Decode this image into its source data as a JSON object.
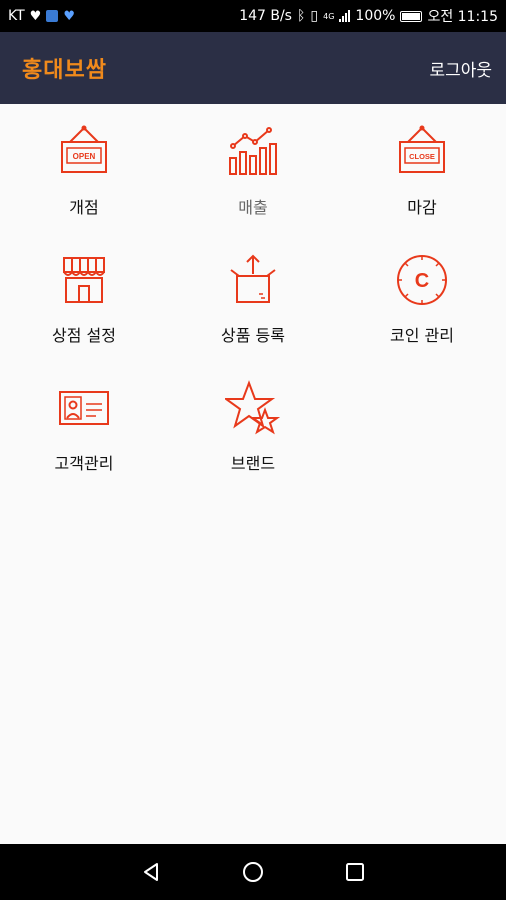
{
  "status": {
    "carrier": "KT",
    "net_speed": "147 B/s",
    "network": "4G",
    "battery": "100%",
    "time": "오전 11:15"
  },
  "appbar": {
    "title": "홍대보쌈",
    "logout_label": "로그아웃"
  },
  "menu": {
    "items": [
      {
        "label": "개점",
        "icon": "open-sign-icon"
      },
      {
        "label": "매출",
        "icon": "sales-chart-icon"
      },
      {
        "label": "마감",
        "icon": "close-sign-icon"
      },
      {
        "label": "상점 설정",
        "icon": "store-icon"
      },
      {
        "label": "상품 등록",
        "icon": "product-box-icon"
      },
      {
        "label": "코인 관리",
        "icon": "coin-icon"
      },
      {
        "label": "고객관리",
        "icon": "customer-card-icon"
      },
      {
        "label": "브랜드",
        "icon": "stars-icon"
      }
    ],
    "open_sign_text": "OPEN",
    "close_sign_text": "CLOSE",
    "coin_letter": "C"
  },
  "colors": {
    "accent": "#f08a1c",
    "icon": "#e8391b",
    "appbar": "#2b2f45"
  }
}
